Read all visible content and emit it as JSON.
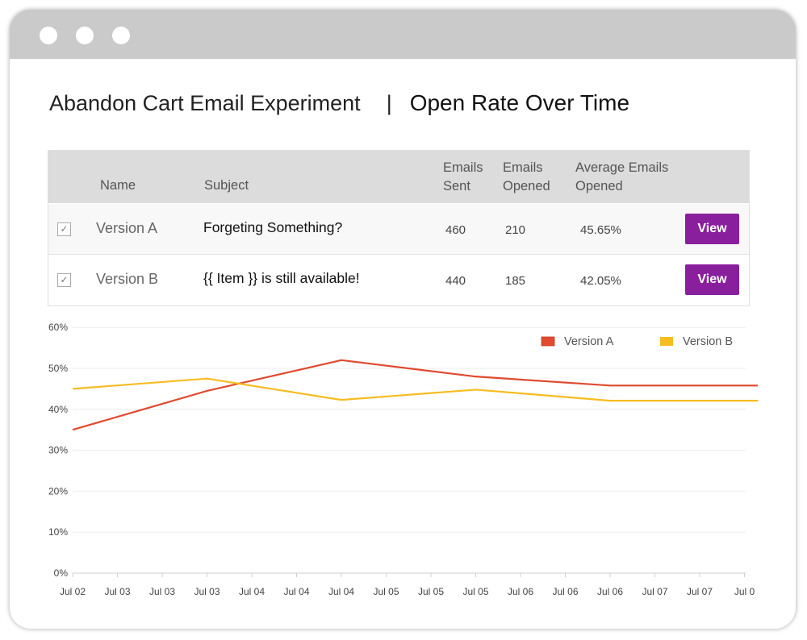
{
  "window": {
    "title_left": "Abandon Cart Email Experiment",
    "separator": "|",
    "title_right": "Open Rate Over Time"
  },
  "table": {
    "headers": {
      "name": "Name",
      "subject": "Subject",
      "sent": [
        "Emails",
        "Sent"
      ],
      "opened": [
        "Emails",
        "Opened"
      ],
      "avg": [
        "Average Emails",
        "Opened"
      ]
    },
    "rows": [
      {
        "checked": true,
        "checkmark": "✓",
        "name": "Version A",
        "subject": "Forgeting Something?",
        "sent": "460",
        "opened": "210",
        "avg": "45.65%",
        "action": "View"
      },
      {
        "checked": true,
        "checkmark": "✓",
        "name": "Version B",
        "subject": "{{ Item }} is still available!",
        "sent": "440",
        "opened": "185",
        "avg": "42.05%",
        "action": "View"
      }
    ]
  },
  "chart_data": {
    "type": "line",
    "categories": [
      "Jul 02",
      "Jul 03",
      "Jul 03",
      "Jul 03",
      "Jul 04",
      "Jul 04",
      "Jul 04",
      "Jul 05",
      "Jul 05",
      "Jul 05",
      "Jul 06",
      "Jul 06",
      "Jul 06",
      "Jul 07",
      "Jul 07",
      "Jul 0"
    ],
    "yticks": [
      "0%",
      "10%",
      "20%",
      "30%",
      "40%",
      "50%",
      "60%"
    ],
    "ylim": [
      0,
      60
    ],
    "grid": true,
    "legend_position": "top-right",
    "series": [
      {
        "name": "Version A",
        "color": "#e04a2f",
        "x": [
          0,
          3,
          6,
          9,
          12,
          15,
          15.3
        ],
        "y": [
          35,
          44.5,
          52,
          48,
          45.8,
          45.8,
          45.8
        ]
      },
      {
        "name": "Version B",
        "color": "#f7bc1f",
        "x": [
          0,
          3,
          6,
          9,
          12,
          15,
          15.3
        ],
        "y": [
          45,
          47.5,
          42.3,
          44.8,
          42.1,
          42.1,
          42.1
        ]
      }
    ]
  },
  "colors": {
    "titlebar": "#cbcaca",
    "button": "#8a1f9e",
    "header_bg": "#dcdcdc"
  }
}
